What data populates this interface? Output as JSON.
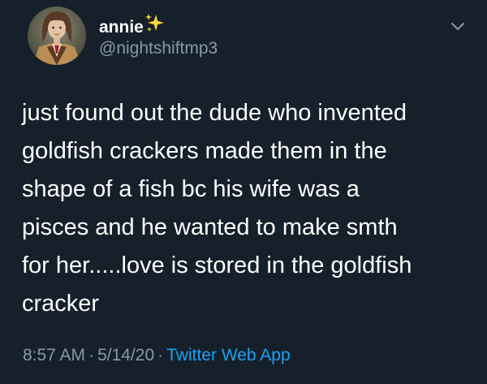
{
  "author": {
    "display_name": "annie",
    "handle": "@nightshiftmp3",
    "name_emoji": "sparkles"
  },
  "tweet": {
    "text_lines": [
      "just found out the dude who invented",
      "goldfish crackers made them in the",
      "shape of a fish bc his wife was a",
      "pisces and he wanted to make smth",
      "for her.....love is stored in the goldfish",
      "cracker"
    ]
  },
  "meta": {
    "time": "8:57 AM",
    "separator": "·",
    "date": "5/14/20",
    "source": "Twitter Web App"
  },
  "colors": {
    "background": "#15202b",
    "text": "#ffffff",
    "secondary": "#8899a6",
    "link": "#1da1f2",
    "sparkle": "#ffd93b"
  }
}
